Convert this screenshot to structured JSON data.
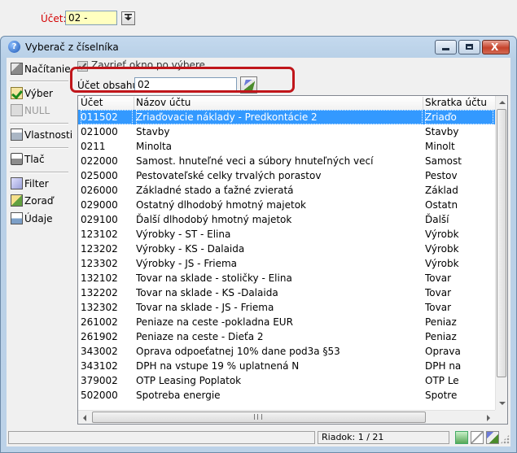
{
  "top": {
    "account_label": "Účet:",
    "account_value": "02 -"
  },
  "window": {
    "title": "Vyberač z číselníka",
    "min_symbol": "",
    "max_symbol": "",
    "close_symbol": "X"
  },
  "toolbar": {
    "load": "Načítanie",
    "select": "Výber",
    "null": "NULL",
    "properties": "Vlastnosti",
    "print": "Tlač",
    "filter": "Filter",
    "sort": "Zoraď",
    "data": "Údaje"
  },
  "options": {
    "close_after_select": "Zavrieť okno po výbere",
    "close_after_select_checked": true
  },
  "filter": {
    "label": "Účet obsahuje",
    "value": "02"
  },
  "grid": {
    "columns": [
      "Účet",
      "Názov účtu",
      "Skratka účtu"
    ],
    "selected_index": 0,
    "rows": [
      [
        "011502",
        "Zriaďovacie náklady - Predkontácie 2",
        "Zriaďo"
      ],
      [
        "021000",
        "Stavby",
        "Stavby"
      ],
      [
        "0211",
        "Minolta",
        "Minolt"
      ],
      [
        "022000",
        "Samost. hnuteľné veci a súbory hnuteľných vecí",
        "Samost"
      ],
      [
        "025000",
        "Pestovateľské celky trvalých porastov",
        "Pestov"
      ],
      [
        "026000",
        "Základné stado a ťažné zvieratá",
        "Základ"
      ],
      [
        "029000",
        "Ostatný dlhodobý hmotný majetok",
        "Ostatn"
      ],
      [
        "029100",
        "Ďalší dlhodobý hmotný majetok",
        "Ďalší"
      ],
      [
        "123102",
        "Výrobky - ST - Elina",
        "Výrobk"
      ],
      [
        "123202",
        "Výrobky - KS - Dalaida",
        "Výrobk"
      ],
      [
        "123302",
        "Výrobky - JS - Friema",
        "Výrobk"
      ],
      [
        "132102",
        "Tovar na sklade - stoličky - Elina",
        "Tovar"
      ],
      [
        "132202",
        "Tovar na sklade - KS -Dalaida",
        "Tovar"
      ],
      [
        "132302",
        "Tovar na sklade - JS - Friema",
        "Tovar"
      ],
      [
        "261002",
        "Peniaze na ceste -pokladna EUR",
        "Peniaz"
      ],
      [
        "261902",
        "Peniaze na ceste - Dieťa 2",
        "Peniaz"
      ],
      [
        "343002",
        "Oprava odpoeťatnej 10% dane pod3a §53",
        "Oprava"
      ],
      [
        "343102",
        "DPH na vstupe 19 % uplatnená N",
        "DPH na"
      ],
      [
        "379002",
        "OTP Leasing Poplatok",
        "OTP Le"
      ],
      [
        "502000",
        "Spotreba energie",
        "Spotre"
      ]
    ]
  },
  "status": {
    "row_info": "Riadok: 1 / 21"
  },
  "colors": {
    "selection": "#3399ff",
    "highlight_box": "#c0161b",
    "account_label": "#d40000",
    "account_input_bg": "#ffffc0"
  }
}
